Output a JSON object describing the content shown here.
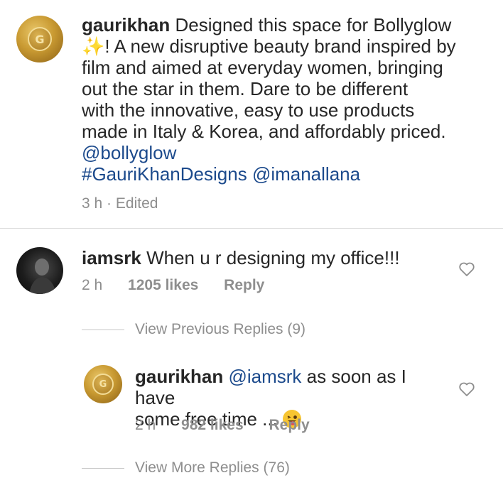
{
  "post": {
    "username": "gaurikhan",
    "caption_text": "Designed this space for Bollyglow",
    "caption_emoji": "✨",
    "caption_rest_line1": "! A new disruptive beauty brand inspired by",
    "caption_line3": "film and aimed at everyday women, bringing",
    "caption_line4": "out the star in them. Dare to be different",
    "caption_line5": "with the innovative, easy to use products",
    "caption_line6": "made in Italy & Korea, and affordably priced.",
    "mention_brand": "@bollyglow",
    "hashtag": "#GauriKhanDesigns",
    "mention_user": "@imanallana",
    "time": "3 h",
    "separator": "·",
    "edited": "Edited"
  },
  "comment": {
    "username": "iamsrk",
    "text": "When u r designing my office!!!",
    "time": "2 h",
    "likes": "1205 likes",
    "reply_label": "Reply"
  },
  "view_previous": "View Previous Replies (9)",
  "reply": {
    "username": "gaurikhan",
    "mention": "@iamsrk",
    "text_line1": "as soon as I have",
    "text_line2": "some free time ...",
    "time": "2 h",
    "likes": "982 likes",
    "reply_label": "Reply"
  },
  "view_more": "View More Replies (76)",
  "icons": {
    "heart": "heart-outline-icon",
    "avatar_logo": "bollyglow-logo",
    "emoji": "winking-tongue-emoji"
  }
}
